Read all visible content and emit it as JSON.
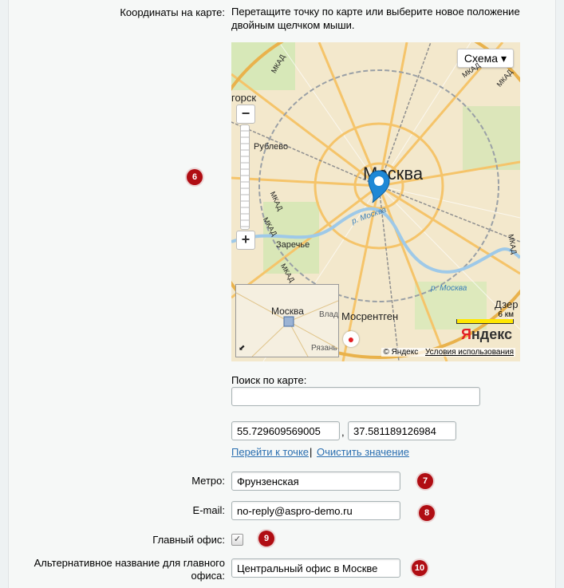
{
  "coords_section": {
    "label": "Координаты на карте:",
    "hint": "Перетащите точку по карте или выберите новое положение двойным щелчком мыши.",
    "badge": "6"
  },
  "map": {
    "type_button": "Схема ▾",
    "city_label": "Москва",
    "river_label": "р. Москва",
    "river_label_2": "р. Москва",
    "places": [
      "горск",
      "Рублево",
      "Заречье",
      "Мосрентген",
      "Дзер"
    ],
    "road_labels": [
      "МКАД",
      "МКАД",
      "МКАД",
      "МКАД",
      "МКАД",
      "МКАД",
      "МКАД"
    ],
    "zoom_in": "+",
    "zoom_out": "−",
    "minimap_city": "Москва",
    "minimap_places": [
      "Влад",
      "Рязань"
    ],
    "scale": "6 км",
    "logo_letter": "Я",
    "logo_rest": "ндекс",
    "copyright": "© Яндекс",
    "terms": "Условия использования"
  },
  "search": {
    "label": "Поиск по карте:",
    "value": ""
  },
  "coords": {
    "lat": "55.729609569005",
    "separator": ",",
    "lon": "37.581189126984",
    "goto_link": "Перейти к точке",
    "link_sep": "|",
    "clear_link": "Очистить значение"
  },
  "metro": {
    "label": "Метро:",
    "value": "Фрунзенская",
    "badge": "7"
  },
  "email": {
    "label": "E-mail:",
    "value": "no-reply@aspro-demo.ru",
    "badge": "8"
  },
  "main_office": {
    "label": "Главный офис:",
    "checked": "✓",
    "badge": "9"
  },
  "alt_name": {
    "label_line1": "Альтернативное название для главного",
    "label_line2": "офиса:",
    "value": "Центральный офис в Москве",
    "badge": "10"
  },
  "colors": {
    "badge": "#b00d13",
    "link": "#2b6fb0",
    "marker": "#1e88d6",
    "road": "#f5c46a",
    "mkad": "#e9b24c"
  }
}
